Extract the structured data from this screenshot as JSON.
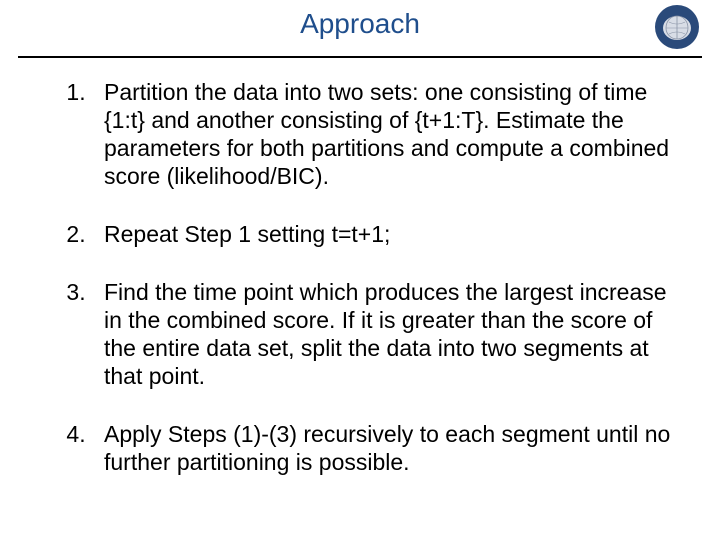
{
  "header": {
    "title": "Approach"
  },
  "steps": {
    "s1": "Partition the data into two sets: one consisting of time {1:t} and another consisting of {t+1:T}. Estimate the parameters for both partitions and compute a combined score (likelihood/BIC).",
    "s2": "Repeat Step 1 setting t=t+1;",
    "s3": "Find the time point which produces the largest increase in the combined score. If it is greater than the score of the entire data set, split the data into two segments at that point.",
    "s4": "Apply Steps (1)-(3) recursively to each segment until no further partitioning is possible."
  }
}
